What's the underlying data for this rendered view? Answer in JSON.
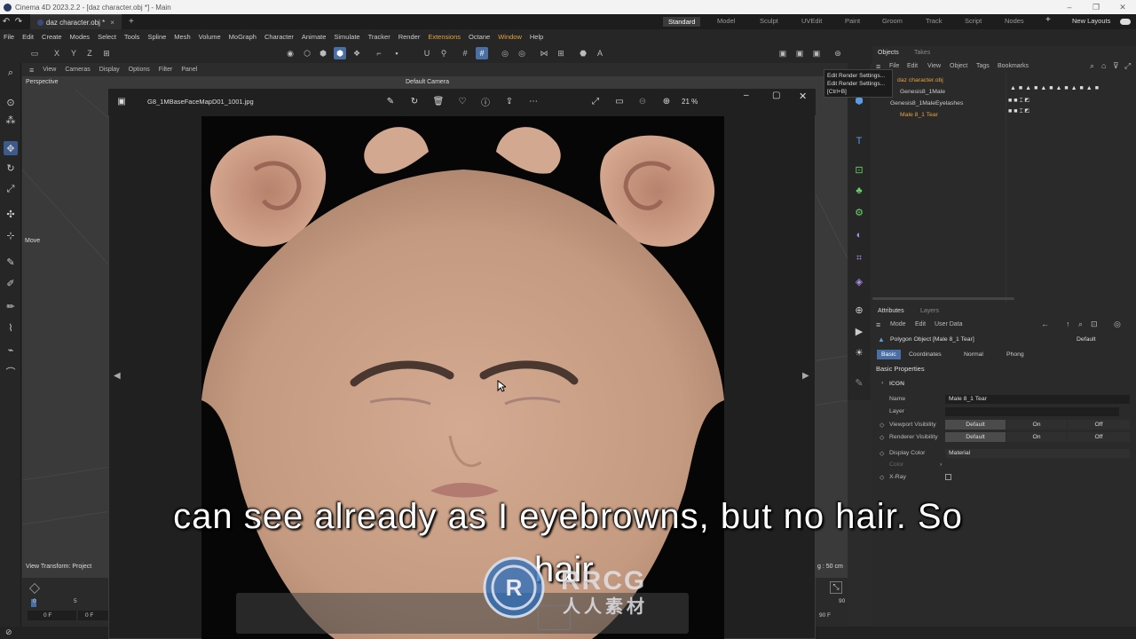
{
  "window": {
    "title": "Cinema 4D 2023.2.2 - [daz character.obj *] - Main",
    "controls": [
      "–",
      "❐",
      "✕"
    ]
  },
  "tabs": {
    "document": "daz character.obj *",
    "layouts": [
      "Standard",
      "Model",
      "Sculpt",
      "UVEdit",
      "Paint",
      "Groom",
      "Track",
      "Script",
      "Nodes"
    ],
    "new_layouts": "New Layouts"
  },
  "menu": [
    "File",
    "Edit",
    "Create",
    "Modes",
    "Select",
    "Tools",
    "Spline",
    "Mesh",
    "Volume",
    "MoGraph",
    "Character",
    "Animate",
    "Simulate",
    "Tracker",
    "Render",
    "Extensions",
    "Octane",
    "Window",
    "Help"
  ],
  "axes": [
    "X",
    "Y",
    "Z"
  ],
  "viewport": {
    "menu": [
      "View",
      "Cameras",
      "Display",
      "Options",
      "Filter",
      "Panel"
    ],
    "label": "Perspective",
    "camera": "Default Camera",
    "move": "Move",
    "transform": "View Transform: Project",
    "grid": "g : 50 cm"
  },
  "timeline": {
    "frame_start": "0 F",
    "frame_current": "0 F",
    "tick_0": "0",
    "tick_5": "5",
    "end_tick": "90",
    "end_frame": "90 F"
  },
  "tooltip": {
    "line1": "Edit Render Settings...",
    "line2": "Edit Render Settings...",
    "line3": "[Ctrl+B]"
  },
  "objects_panel": {
    "tabs": [
      "Objects",
      "Takes"
    ],
    "menu": [
      "File",
      "Edit",
      "View",
      "Object",
      "Tags",
      "Bookmarks"
    ],
    "rows": [
      "daz character.obj",
      "Genesis8_1Male",
      "Genesis8_1MaleEyelashes",
      "Male 8_1 Tear"
    ]
  },
  "attributes_panel": {
    "tabs": [
      "Attributes",
      "Layers"
    ],
    "menu": [
      "Mode",
      "Edit",
      "User Data"
    ],
    "object_title": "Polygon Object [Male 8_1 Tear]",
    "preset": "Default",
    "subtabs": [
      "Basic",
      "Coordinates",
      "Normal",
      "Phong"
    ],
    "section": "Basic Properties",
    "icon_label": "ICON",
    "fields": {
      "name_label": "Name",
      "name_value": "Male 8_1 Tear",
      "layer_label": "Layer",
      "viewport_vis_label": "Viewport Visibility",
      "renderer_vis_label": "Renderer Visibility",
      "default": "Default",
      "on": "On",
      "off": "Off",
      "display_color_label": "Display Color",
      "display_color_value": "Material",
      "color_label": "Color",
      "xray_label": "X-Ray"
    }
  },
  "photo_viewer": {
    "filename": "G8_1MBaseFaceMapD01_1001.jpg",
    "zoom": "21 %"
  },
  "subtitle": {
    "line1": "can see already as I eyebrowns, but no hair. So",
    "line2": "hair"
  },
  "watermark": {
    "text": "RRCG",
    "sub": "人人素材"
  },
  "colors": {
    "accent_blue": "#4a6fa5",
    "highlight_orange": "#e5a33f",
    "skin": "#c9a088"
  }
}
